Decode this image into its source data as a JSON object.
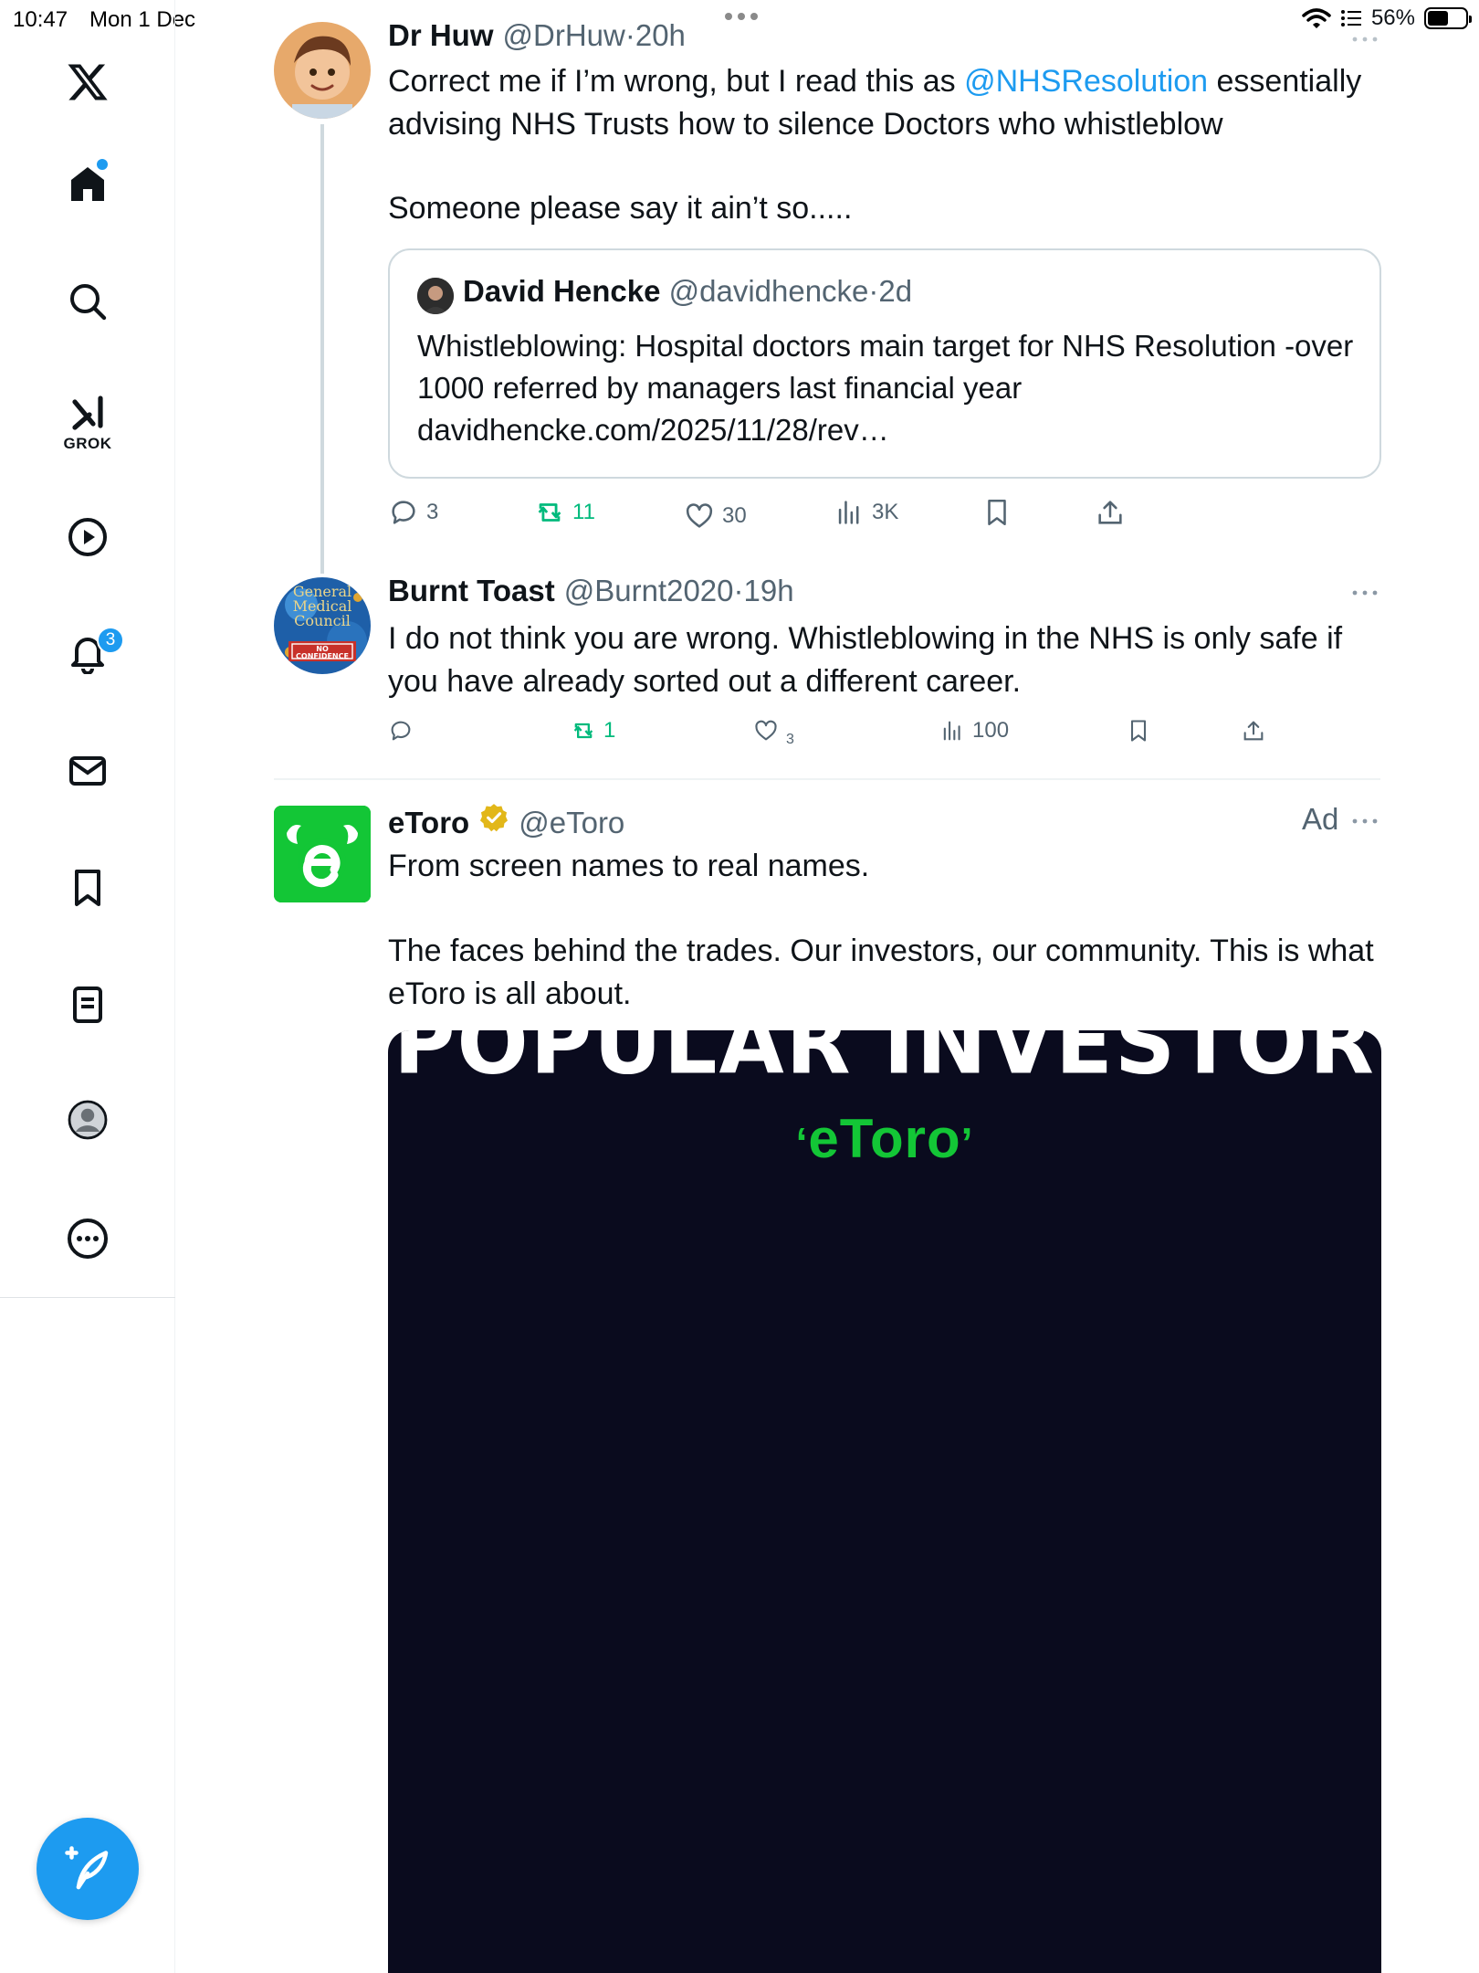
{
  "status_bar": {
    "time": "10:47",
    "date": "Mon 1 Dec",
    "battery": "56%",
    "battery_level": 0.56
  },
  "sidebar": {
    "grok_label": "GROK",
    "notifications_count": "3",
    "items": [
      {
        "name": "x-logo"
      },
      {
        "name": "home"
      },
      {
        "name": "explore"
      },
      {
        "name": "grok"
      },
      {
        "name": "videos"
      },
      {
        "name": "notifications"
      },
      {
        "name": "messages"
      },
      {
        "name": "bookmarks"
      },
      {
        "name": "lists"
      },
      {
        "name": "profile"
      },
      {
        "name": "more"
      }
    ]
  },
  "tweets": [
    {
      "name": "Dr Huw",
      "handle": "@DrHuw",
      "sep": "·",
      "time": "20h",
      "text_before": "Correct me if I’m wrong, but I read this as ",
      "mention": "@NHSResolution",
      "text_after": " essentially advising NHS Trusts how to silence Doctors who whistleblow",
      "text_line2": "Someone please say it ain’t so.....",
      "quote": {
        "name": "David Hencke",
        "handle": "@davidhencke",
        "sep": "·",
        "time": "2d",
        "text": "Whistleblowing: Hospital doctors main target for NHS Resolution -over 1000 referred by managers last financial year davidhencke.com/2025/11/28/rev…"
      },
      "actions": {
        "replies": "3",
        "reposts": "11",
        "likes": "30",
        "views": "3K"
      }
    },
    {
      "name": "Burnt Toast",
      "handle": "@Burnt2020",
      "sep": "·",
      "time": "19h",
      "text": "I do not think you are wrong. Whistleblowing in the NHS is only safe if you have already sorted out a different career.",
      "avatar_text": "General Medical Council",
      "avatar_badge": "NO CONFIDENCE",
      "actions": {
        "replies": "",
        "reposts": "1",
        "likes": "3",
        "views": "100"
      }
    },
    {
      "name": "eToro",
      "handle": "@eToro",
      "ad_label": "Ad",
      "text_line1": "From screen names to real names.",
      "text_line2": "The faces behind the trades. Our investors, our community. This is what eToro is all about.",
      "media": {
        "headline": "POPULAR INVESTOR",
        "brand": "eToro"
      }
    }
  ],
  "colors": {
    "accent": "#1d9bf0",
    "repost_green": "#00ba7c",
    "secondary_text": "#536471",
    "etoro_green": "#13c636"
  }
}
